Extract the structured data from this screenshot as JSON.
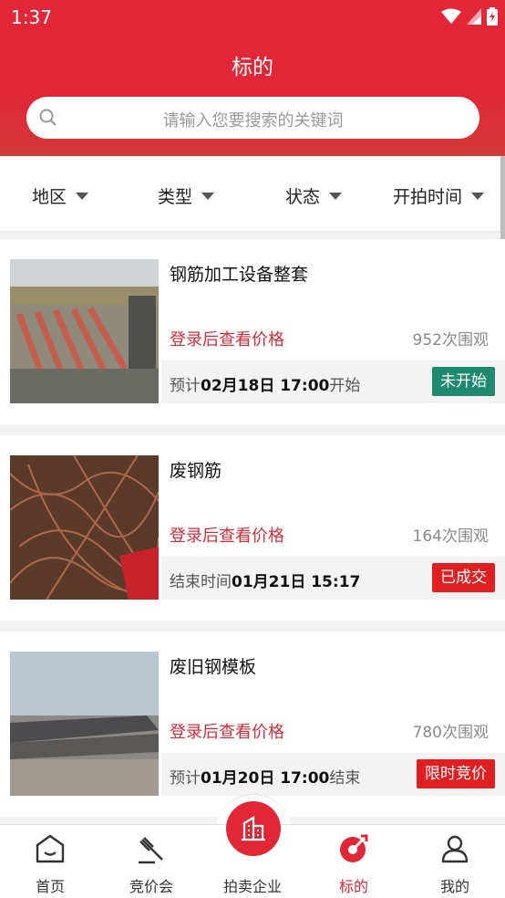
{
  "status_bar": {
    "time": "1:37"
  },
  "header": {
    "title": "标的"
  },
  "search": {
    "placeholder": "请输入您要搜索的关键词"
  },
  "filters": [
    {
      "label": "地区"
    },
    {
      "label": "类型"
    },
    {
      "label": "状态"
    },
    {
      "label": "开拍时间"
    }
  ],
  "listings": [
    {
      "name": "钢筋加工设备整套",
      "price_text": "登录后查看价格",
      "views": "952次围观",
      "time_prefix": "预计",
      "time": "02月18日 17:00",
      "time_suffix": "开始",
      "status": "未开始",
      "status_color": "#1f8a6e"
    },
    {
      "name": "废钢筋",
      "price_text": "登录后查看价格",
      "views": "164次围观",
      "time_prefix": "结束时间",
      "time": "01月21日 15:17",
      "time_suffix": "",
      "status": "已成交",
      "status_color": "#e02020"
    },
    {
      "name": "废旧钢模板",
      "price_text": "登录后查看价格",
      "views": "780次围观",
      "time_prefix": "预计",
      "time": "01月20日 17:00",
      "time_suffix": "结束",
      "status": "限时竞价",
      "status_color": "#e02020"
    }
  ],
  "tabbar": [
    {
      "label": "首页",
      "icon": "home-icon"
    },
    {
      "label": "竞价会",
      "icon": "gavel-icon"
    },
    {
      "label": "拍卖企业",
      "icon": "building-icon"
    },
    {
      "label": "标的",
      "icon": "target-icon",
      "active": true
    },
    {
      "label": "我的",
      "icon": "user-icon"
    }
  ],
  "colors": {
    "brand": "#e02637",
    "active_tab": "#e02637"
  }
}
